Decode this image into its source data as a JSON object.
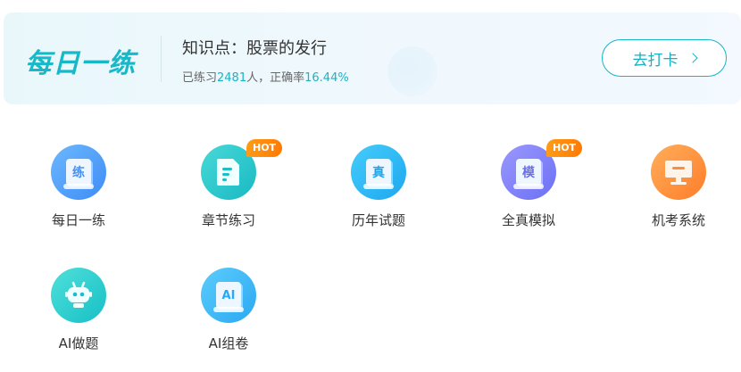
{
  "banner": {
    "title": "每日一练",
    "knowledge_point": "知识点：股票的发行",
    "stats_prefix": "已练习",
    "stats_count": "2481",
    "stats_mid": "人，正确率",
    "stats_rate": "16.44%",
    "checkin_label": "去打卡",
    "accent_color": "#17b8c8"
  },
  "features": [
    {
      "label": "每日一练",
      "glyph": "练",
      "icon": "daily-practice-icon",
      "hot": false
    },
    {
      "label": "章节练习",
      "glyph": "",
      "icon": "chapter-document-icon",
      "hot": true
    },
    {
      "label": "历年试题",
      "glyph": "真",
      "icon": "past-exams-icon",
      "hot": false
    },
    {
      "label": "全真模拟",
      "glyph": "模",
      "icon": "mock-exam-icon",
      "hot": true
    },
    {
      "label": "机考系统",
      "glyph": "",
      "icon": "computer-monitor-icon",
      "hot": false
    },
    {
      "label": "AI做题",
      "glyph": "",
      "icon": "robot-icon",
      "hot": false
    },
    {
      "label": "AI组卷",
      "glyph": "AI",
      "icon": "ai-paper-icon",
      "hot": false
    }
  ],
  "hot_badge": "HOT",
  "colors": {
    "hot": "#ff8a00",
    "label": "#333333"
  }
}
